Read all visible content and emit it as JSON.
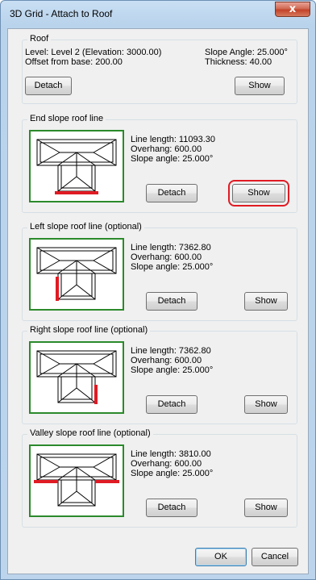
{
  "window": {
    "title": "3D Grid - Attach to Roof",
    "close_glyph": "x"
  },
  "roof": {
    "legend": "Roof",
    "level": "Level: Level 2  (Elevation: 3000.00)",
    "offset": "Offset from base: 200.00",
    "slope_angle": "Slope Angle: 25.000°",
    "thickness": "Thickness: 40.00",
    "detach_label": "Detach",
    "show_label": "Show"
  },
  "sections": [
    {
      "legend": "End slope roof line",
      "line_length": "Line length: 11093.30",
      "overhang": "Overhang: 600.00",
      "slope_angle": "Slope angle: 25.000°",
      "detach_label": "Detach",
      "show_label": "Show",
      "highlight_line": "bottom-end"
    },
    {
      "legend": "Left slope roof line (optional)",
      "line_length": "Line length: 7362.80",
      "overhang": "Overhang: 600.00",
      "slope_angle": "Slope angle: 25.000°",
      "detach_label": "Detach",
      "show_label": "Show",
      "highlight_line": "left-wing"
    },
    {
      "legend": "Right slope roof line (optional)",
      "line_length": "Line length: 7362.80",
      "overhang": "Overhang: 600.00",
      "slope_angle": "Slope angle: 25.000°",
      "detach_label": "Detach",
      "show_label": "Show",
      "highlight_line": "right-wing"
    },
    {
      "legend": "Valley slope roof line (optional)",
      "line_length": "Line length: 3810.00",
      "overhang": "Overhang: 600.00",
      "slope_angle": "Slope angle: 25.000°",
      "detach_label": "Detach",
      "show_label": "Show",
      "highlight_line": "valley"
    }
  ],
  "footer": {
    "ok_label": "OK",
    "cancel_label": "Cancel"
  },
  "colors": {
    "highlight_line": "#e01b24",
    "preview_border": "#2b8a2b",
    "focus_box": "#e01b24"
  }
}
